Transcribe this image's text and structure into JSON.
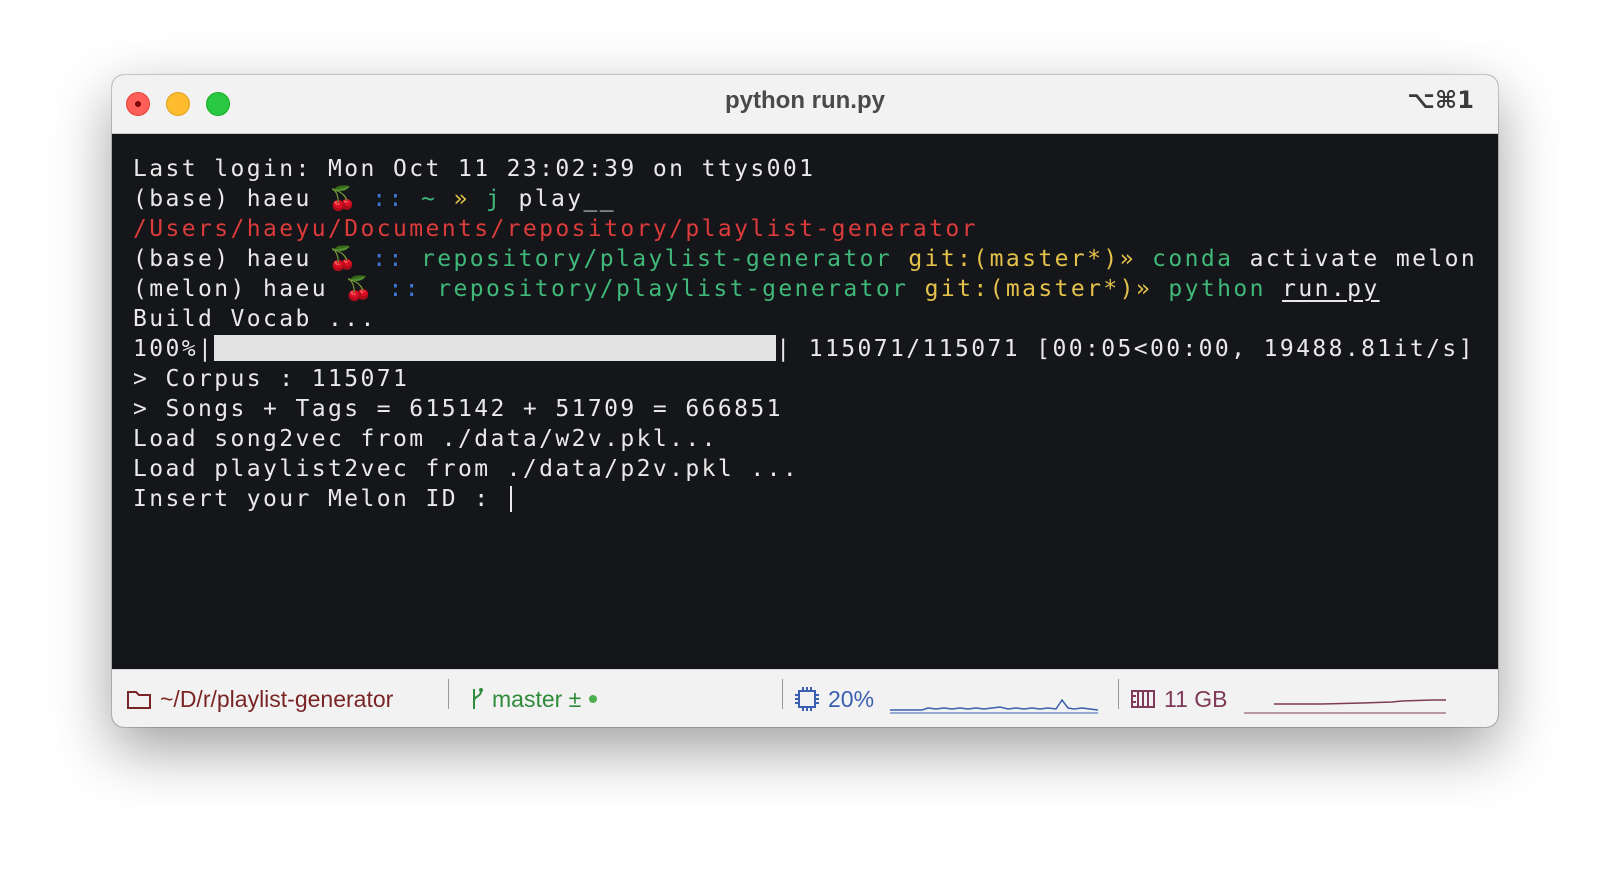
{
  "window": {
    "title": "python run.py",
    "shortcut": "⌥⌘1"
  },
  "terminal": {
    "login_line": "Last login: Mon Oct 11 23:02:39 on ttys001",
    "prompt1": {
      "env": "(base) haeu",
      "sep": "::",
      "dir": "~",
      "arrow": "»",
      "cmd": "j",
      "arg": "play__"
    },
    "jump_output": "/Users/haeyu/Documents/repository/playlist-generator",
    "prompt2": {
      "env": "(base) haeu",
      "sep": "::",
      "dir": "repository/playlist-generator",
      "git": "git:(master*)",
      "arrow": "»",
      "cmd": "conda",
      "arg": "activate melon"
    },
    "prompt3": {
      "env": "(melon) haeu",
      "sep": "::",
      "dir": "repository/playlist-generator",
      "git": "git:(master*)",
      "arrow": "»",
      "cmd": "python",
      "arg": "run.py"
    },
    "build_vocab": "Build Vocab ...",
    "progress": {
      "percent_label": "100%|",
      "fraction": 1.0,
      "end_bar": "|",
      "stats": "115071/115071 [00:05<00:00, 19488.81it/s]"
    },
    "corpus_line": "> Corpus : 115071",
    "songs_tags_line": "> Songs + Tags = 615142 + 51709 = 666851",
    "load_song2vec": "Load song2vec from ./data/w2v.pkl...",
    "load_playlist2vec": "Load playlist2vec from ./data/p2v.pkl ...",
    "input_prompt": "Insert your Melon ID : "
  },
  "statusbar": {
    "path": "~/D/r/playlist-generator",
    "branch": "master ±",
    "cpu": "20%",
    "memory": "11 GB"
  },
  "colors": {
    "terminal_bg": "#15161a",
    "path_red": "#dc3b3b",
    "prompt_blue": "#3c79d6",
    "dir_green": "#3fb87a",
    "git_yellow": "#e4c24a"
  },
  "icons": {
    "folder": "folder-icon",
    "branch": "git-branch-icon",
    "cpu": "cpu-icon",
    "memory": "memory-icon",
    "emoji": "🍒"
  }
}
